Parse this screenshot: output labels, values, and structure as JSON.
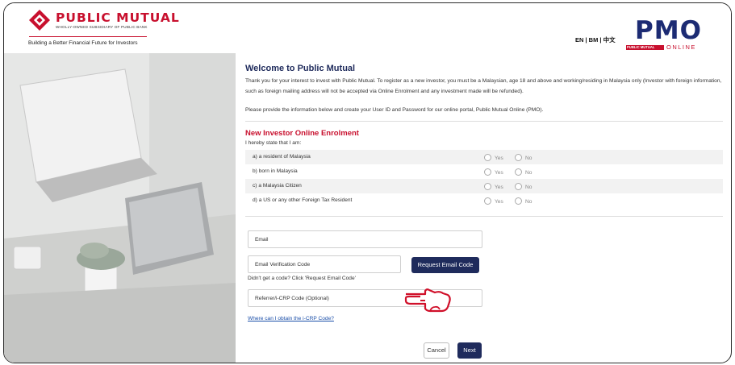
{
  "header": {
    "brand": "PUBLIC MUTUAL",
    "sub_brand": "WHOLLY-OWNED SUBSIDIARY OF PUBLIC BANK",
    "tagline": "Building a Better Financial Future for Investors",
    "languages": "EN | BM | 中文",
    "pmo_logo": "PMO",
    "pmo_bar": "PUBLIC MUTUAL",
    "pmo_online": "ONLINE"
  },
  "main": {
    "title": "Welcome to Public Mutual",
    "intro": "Thank you for your interest to invest with Public Mutual. To register as a new investor, you must be a Malaysian, age 18 and above and working/residing in Malaysia only (Investor with foreign information, such as foreign mailing address will not be accepted via Online Enrolment and any investment made will be refunded).",
    "instruction": "Please provide the information below and create your User ID and Password for our online portal, Public Mutual Online (PMO).",
    "section_title": "New Investor Online Enrolment",
    "statement": "I hereby state that I am:",
    "questions": [
      {
        "label": "a) a resident of Malaysia",
        "yes": "Yes",
        "no": "No"
      },
      {
        "label": "b) born in Malaysia",
        "yes": "Yes",
        "no": "No"
      },
      {
        "label": "c) a Malaysia Citizen",
        "yes": "Yes",
        "no": "No"
      },
      {
        "label": "d) a US or any other Foreign Tax Resident",
        "yes": "Yes",
        "no": "No"
      }
    ],
    "email_placeholder": "Email",
    "verification_placeholder": "Email Verification Code",
    "request_code_button": "Request Email Code",
    "no_code_hint": "Didn't get a code? Click 'Request Email Code'",
    "referrer_placeholder": "Referrer/i-CRP Code (Optional)",
    "icrp_link": "Where can I obtain the i-CRP Code?",
    "cancel_button": "Cancel",
    "next_button": "Next"
  },
  "colors": {
    "brand_red": "#c8102e",
    "navy": "#1f2b5c"
  },
  "icons": {
    "logo": "public-mutual-logo",
    "pointer": "pointing-hand-icon"
  }
}
